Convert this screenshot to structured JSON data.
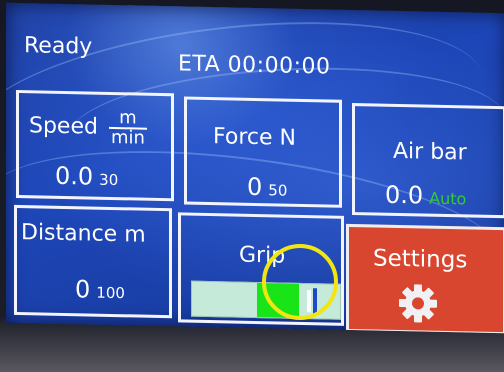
{
  "status": "Ready",
  "eta": "ETA 00:00:00",
  "tiles": {
    "speed": {
      "label": "Speed",
      "unit_num": "m",
      "unit_den": "min",
      "value": "0.0",
      "sub": "30"
    },
    "force": {
      "label": "Force N",
      "value": "0",
      "sub": "50"
    },
    "airbar": {
      "label": "Air bar",
      "value": "0.0",
      "sub": "Auto"
    },
    "distance": {
      "label": "Distance m",
      "value": "0",
      "sub": "100"
    },
    "grip": {
      "label": "Grip",
      "level": 0.72
    },
    "settings": {
      "label": "Settings",
      "icon": "gear-icon"
    }
  },
  "colors": {
    "screen": "#1d46b8",
    "settings_tile": "#d9462f",
    "grip_fill": "#18e418",
    "grip_track": "#c6ead9",
    "auto_text": "#33cc33",
    "highlight": "#f2e612"
  }
}
